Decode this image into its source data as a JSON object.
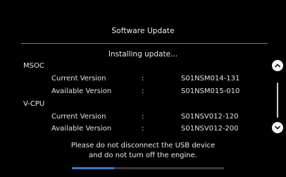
{
  "dialog": {
    "title": "Software Update",
    "status": "Installing update...",
    "notice_line1": "Please do not disconnect the USB device",
    "notice_line2": "and do not turn off the engine."
  },
  "sections": [
    {
      "label": "MSOC",
      "rows": [
        {
          "label": "Current Version",
          "separator": ":",
          "value": "S01NSM014-131"
        },
        {
          "label": "Available Version",
          "separator": ":",
          "value": "S01NSM015-010"
        }
      ]
    },
    {
      "label": "V-CPU",
      "rows": [
        {
          "label": "Current Version",
          "separator": ":",
          "value": "S01NSV012-120"
        },
        {
          "label": "Available Version",
          "separator": ":",
          "value": "S01NSV012-200"
        }
      ]
    }
  ],
  "progress": {
    "fraction": 0.28
  },
  "scroll": {
    "up_icon": "chevron-up-icon",
    "down_icon": "chevron-down-icon",
    "thumb_position": 0.0
  },
  "colors": {
    "background": "#000000",
    "accent": "#2f7ecf",
    "text": "#e8e8e8"
  }
}
